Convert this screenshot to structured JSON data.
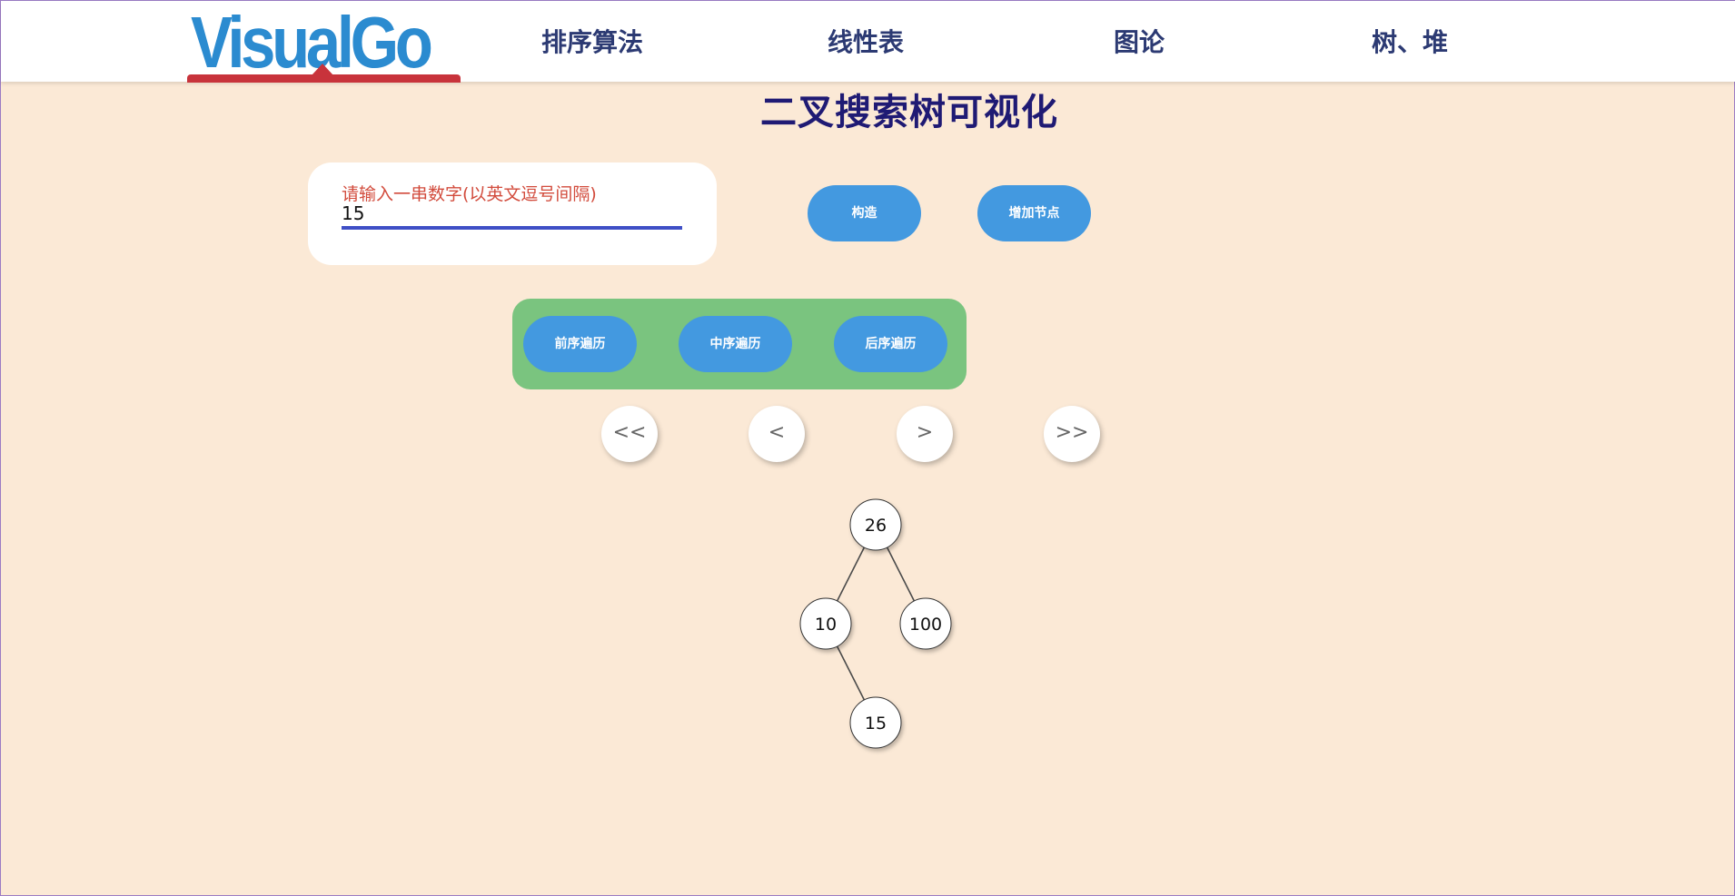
{
  "header": {
    "logo_text": "VisualGo",
    "nav": [
      {
        "label": "排序算法"
      },
      {
        "label": "线性表"
      },
      {
        "label": "图论"
      },
      {
        "label": "树、堆"
      }
    ]
  },
  "main": {
    "title": "二叉搜索树可视化",
    "input": {
      "label": "请输入一串数字(以英文逗号间隔)",
      "value": "15"
    },
    "buttons": {
      "build": "构造",
      "add_node": "增加节点"
    },
    "traversal": {
      "preorder": "前序遍历",
      "inorder": "中序遍历",
      "postorder": "后序遍历"
    },
    "step_controls": {
      "first": "<<",
      "prev": "<",
      "next": ">",
      "last": ">>"
    },
    "tree": {
      "nodes": [
        {
          "id": "n26",
          "value": "26"
        },
        {
          "id": "n10",
          "value": "10"
        },
        {
          "id": "n100",
          "value": "100"
        },
        {
          "id": "n15",
          "value": "15"
        }
      ],
      "edges": [
        [
          "n26",
          "n10"
        ],
        [
          "n26",
          "n100"
        ],
        [
          "n10",
          "n15"
        ]
      ]
    }
  },
  "colors": {
    "background": "#fbe9d6",
    "button_blue": "#4399e0",
    "panel_green": "#7ac47f",
    "title_navy": "#1f1a74",
    "logo_blue": "#2b8bd0",
    "logo_red": "#c8333b",
    "label_red": "#d24b3c"
  }
}
